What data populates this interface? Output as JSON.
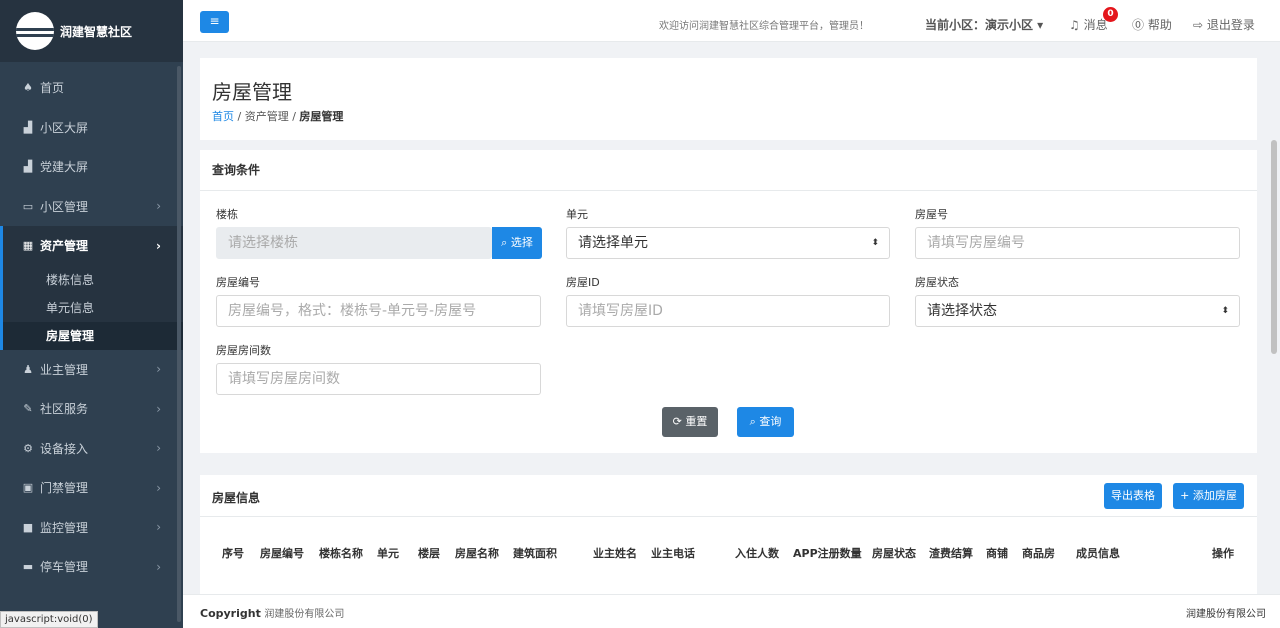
{
  "logo": {
    "text": "润建智慧社区"
  },
  "sidebar": {
    "items": [
      {
        "label": "首页",
        "icon": "home-icon",
        "glyph": "♠",
        "chevron": ""
      },
      {
        "label": "小区大屏",
        "icon": "area-chart-icon",
        "glyph": "▟",
        "chevron": ""
      },
      {
        "label": "党建大屏",
        "icon": "area-chart-icon",
        "glyph": "▟",
        "chevron": ""
      },
      {
        "label": "小区管理",
        "icon": "desktop-icon",
        "glyph": "▭",
        "chevron": "›"
      },
      {
        "label": "资产管理",
        "icon": "building-icon",
        "glyph": "▦",
        "chevron": "›"
      },
      {
        "label": "业主管理",
        "icon": "user-icon",
        "glyph": "♟",
        "chevron": "›"
      },
      {
        "label": "社区服务",
        "icon": "edit-icon",
        "glyph": "✎",
        "chevron": "›"
      },
      {
        "label": "设备接入",
        "icon": "cogs-icon",
        "glyph": "⚙",
        "chevron": "›"
      },
      {
        "label": "门禁管理",
        "icon": "id-card-icon",
        "glyph": "▣",
        "chevron": "›"
      },
      {
        "label": "监控管理",
        "icon": "video-camera-icon",
        "glyph": "■",
        "chevron": "›"
      },
      {
        "label": "停车管理",
        "icon": "car-icon",
        "glyph": "▬",
        "chevron": "›"
      }
    ],
    "submenu": [
      {
        "label": "楼栋信息"
      },
      {
        "label": "单元信息"
      },
      {
        "label": "房屋管理"
      }
    ]
  },
  "status_tip": "javascript:void(0)",
  "topbar": {
    "toggle_glyph": "≡",
    "welcome": "欢迎访问润建智慧社区综合管理平台，管理员！",
    "community": "当前小区：演示小区 ▾",
    "messages": "♫ 消息",
    "badge_count": "0",
    "help": "⓪ 帮助",
    "logout": "⇨ 退出登录"
  },
  "page": {
    "title": "房屋管理",
    "breadcrumb": {
      "home": "首页",
      "sep1": " / ",
      "middle": "资产管理",
      "sep2": " / ",
      "current": "房屋管理"
    }
  },
  "query": {
    "heading": "查询条件",
    "building_label": "楼栋",
    "building_placeholder": "请选择楼栋",
    "select_button": "⌕ 选择",
    "unit_label": "单元",
    "unit_value": "请选择单元",
    "room_no_label": "房屋号",
    "room_no_placeholder": "请填写房屋编号",
    "room_code_label": "房屋编号",
    "room_code_placeholder": "房屋编号，格式：楼栋号-单元号-房屋号",
    "room_id_label": "房屋ID",
    "room_id_placeholder": "请填写房屋ID",
    "status_label": "房屋状态",
    "status_value": "请选择状态",
    "rooms_label": "房屋房间数",
    "rooms_placeholder": "请填写房屋房间数",
    "reset_button": "⟳ 重置",
    "query_button": "⌕ 查询",
    "caret": "⬍"
  },
  "info": {
    "heading": "房屋信息",
    "export_button": "导出表格",
    "add_button": "+ 添加房屋",
    "columns": [
      "序号",
      "房屋编号",
      "楼栋名称",
      "单元",
      "楼层",
      "房屋名称",
      "建筑面积",
      "业主姓名",
      "业主电话",
      "入住人数",
      "APP注册数量",
      "房屋状态",
      "渣费结算",
      "商铺",
      "商品房",
      "成员信息",
      "操作"
    ]
  },
  "footer": {
    "copyright_label": "Copyright",
    "company_left": "润建股份有限公司",
    "company_right": "润建股份有限公司"
  },
  "colors": {
    "sidebar": "#2f4050",
    "accent": "#1e88e5",
    "badge": "#e4161c"
  }
}
